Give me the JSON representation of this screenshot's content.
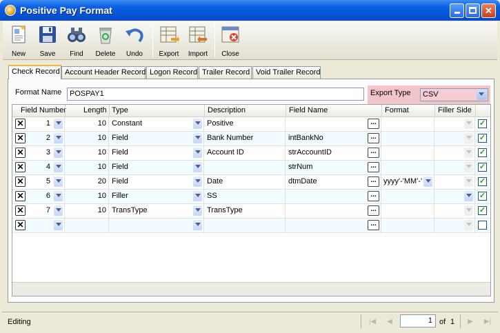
{
  "window": {
    "title": "Positive Pay Format"
  },
  "toolbar": {
    "new": "New",
    "save": "Save",
    "find": "Find",
    "delete": "Delete",
    "undo": "Undo",
    "export": "Export",
    "import": "Import",
    "close": "Close"
  },
  "tabs": [
    "Check Record",
    "Account Header Record",
    "Logon Record",
    "Trailer Record",
    "Void Trailer Record"
  ],
  "active_tab": "Check Record",
  "form": {
    "format_name_label": "Format Name",
    "format_name_value": "POSPAY1",
    "export_type_label": "Export Type",
    "export_type_value": "CSV"
  },
  "grid": {
    "columns": [
      "Field Number",
      "Length",
      "Type",
      "Description",
      "Field Name",
      "Format",
      "Filler Side"
    ],
    "rows": [
      {
        "field_number": "1",
        "length": "10",
        "type": "Constant",
        "description": "Positive",
        "field_name": "",
        "format": "",
        "checked": true
      },
      {
        "field_number": "2",
        "length": "10",
        "type": "Field",
        "description": "Bank Number",
        "field_name": "intBankNo",
        "format": "",
        "checked": true
      },
      {
        "field_number": "3",
        "length": "10",
        "type": "Field",
        "description": "Account ID",
        "field_name": "strAccountID",
        "format": "",
        "checked": true
      },
      {
        "field_number": "4",
        "length": "10",
        "type": "Field",
        "description": "",
        "field_name": "strNum",
        "format": "",
        "checked": true
      },
      {
        "field_number": "5",
        "length": "20",
        "type": "Field",
        "description": "Date",
        "field_name": "dtmDate",
        "format": "yyyy'-'MM'-'",
        "checked": true
      },
      {
        "field_number": "6",
        "length": "10",
        "type": "Filler",
        "description": "SS",
        "field_name": "",
        "format": "",
        "checked": true
      },
      {
        "field_number": "7",
        "length": "10",
        "type": "TransType",
        "description": "TransType",
        "field_name": "",
        "format": "",
        "checked": true
      },
      {
        "field_number": "",
        "length": "",
        "type": "",
        "description": "",
        "field_name": "",
        "format": "",
        "checked": false
      }
    ]
  },
  "status": {
    "text": "Editing",
    "page": "1",
    "of_label": "of",
    "total_pages": "1"
  }
}
